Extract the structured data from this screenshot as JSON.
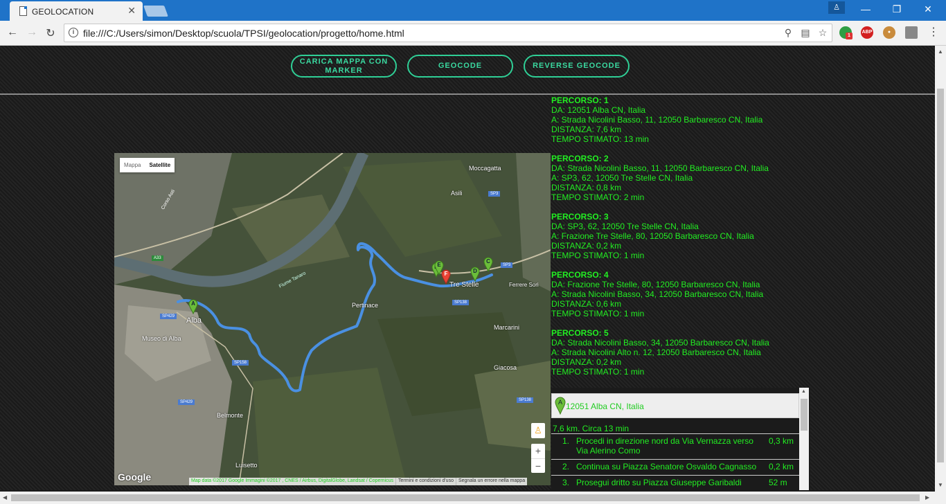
{
  "browser": {
    "tab_title": "GEOLOCATION",
    "tab_close": "✕",
    "url": "file:///C:/Users/simon/Desktop/scuola/TPSI/geolocation/progetto/home.html",
    "ext_abp": "ABP",
    "ext_badge": "1"
  },
  "buttons": {
    "load_map": "CARICA MAPPA CON MARKER",
    "geocode": "GEOCODE",
    "reverse_geocode": "REVERSE GEOCODE"
  },
  "routes": [
    {
      "title": "PERCORSO: 1",
      "from": "DA: 12051 Alba CN, Italia",
      "to": "A: Strada Nicolini Basso, 11, 12050 Barbaresco CN, Italia",
      "distance": "DISTANZA: 7,6 km",
      "time": "TEMPO STIMATO: 13 min"
    },
    {
      "title": "PERCORSO: 2",
      "from": "DA: Strada Nicolini Basso, 11, 12050 Barbaresco CN, Italia",
      "to": "A: SP3, 62, 12050 Tre Stelle CN, Italia",
      "distance": "DISTANZA: 0,8 km",
      "time": "TEMPO STIMATO: 2 min"
    },
    {
      "title": "PERCORSO: 3",
      "from": "DA: SP3, 62, 12050 Tre Stelle CN, Italia",
      "to": "A: Frazione Tre Stelle, 80, 12050 Barbaresco CN, Italia",
      "distance": "DISTANZA: 0,2 km",
      "time": "TEMPO STIMATO: 1 min"
    },
    {
      "title": "PERCORSO: 4",
      "from": "DA: Frazione Tre Stelle, 80, 12050 Barbaresco CN, Italia",
      "to": "A: Strada Nicolini Basso, 34, 12050 Barbaresco CN, Italia",
      "distance": "DISTANZA: 0,6 km",
      "time": "TEMPO STIMATO: 1 min"
    },
    {
      "title": "PERCORSO: 5",
      "from": "DA: Strada Nicolini Basso, 34, 12050 Barbaresco CN, Italia",
      "to": "A: Strada Nicolini Alto n. 12, 12050 Barbaresco CN, Italia",
      "distance": "DISTANZA: 0,2 km",
      "time": "TEMPO STIMATO: 1 min"
    }
  ],
  "map": {
    "type_map": "Mappa",
    "type_satellite": "Satellite",
    "google": "Google",
    "attribution": "Map data ©2017 Google Immagini ©2017 , CNES / Airbus, DigitalGlobe, Landsat / Copernicus",
    "terms": "Termini e condizioni d'uso",
    "report": "Segnala un errore nella mappa",
    "labels": {
      "moccagatta": "Moccagatta",
      "asili": "Asili",
      "alba": "Alba",
      "museo": "Museo di Alba",
      "pertinace": "Pertinace",
      "tre_stelle": "Tre Stelle",
      "marcarini": "Marcarini",
      "belmonte": "Belmonte",
      "giacosa": "Giacosa",
      "luisetto": "Luisetto",
      "fiume": "Fiume Tanaro",
      "corso_asti": "Corso Asti",
      "ferrere": "Ferrere Sori",
      "sp3": "SP3",
      "sp3b": "SP3",
      "sp429": "SP429",
      "sp429b": "SP429",
      "sp138": "SP138",
      "sp138b": "SP138",
      "sp158": "SP158",
      "a33": "A33"
    },
    "markers": {
      "a": "A",
      "b": "B",
      "c": "C",
      "d": "D",
      "e": "E",
      "f": "F"
    }
  },
  "directions": {
    "start_marker": "A",
    "start_address": "12051 Alba CN, Italia",
    "summary": "7,6 km. Circa 13 min",
    "steps": [
      {
        "num": "1.",
        "text": "Procedi in direzione nord da Via Vernazza verso Via Alerino Como",
        "dist": "0,3 km"
      },
      {
        "num": "2.",
        "text": "Continua su Piazza Senatore Osvaldo Cagnasso",
        "dist": "0,2 km"
      },
      {
        "num": "3.",
        "text": "Prosegui dritto su Piazza Giuseppe Garibaldi",
        "dist": "52 m"
      }
    ]
  }
}
